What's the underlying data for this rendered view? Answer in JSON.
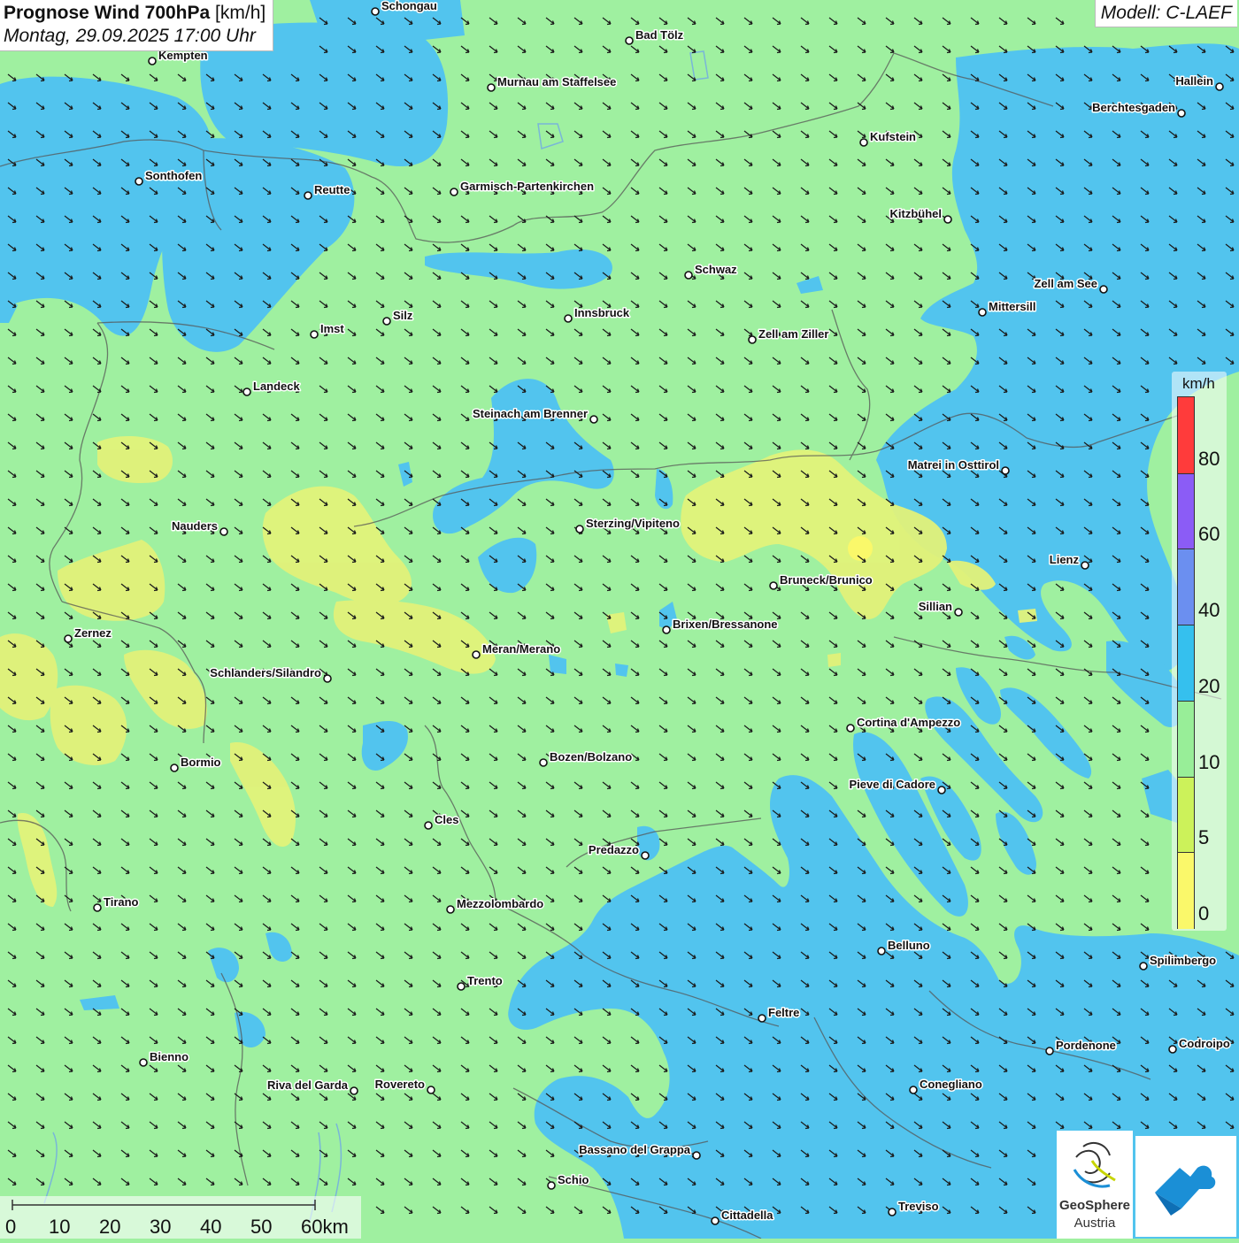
{
  "header": {
    "title": "Prognose Wind 700hPa",
    "unit": "[km/h]",
    "datetime": "Montag, 29.09.2025 17:00 Uhr",
    "model": "Modell: C-LAEF"
  },
  "legend": {
    "unit": "km/h",
    "labels": [
      "80",
      "60",
      "40",
      "20",
      "10",
      "5",
      "0"
    ],
    "colors": [
      "#ff3b3b",
      "#8b5cf6",
      "#6b8ff0",
      "#35c0ee",
      "#98ee98",
      "#ccf25a",
      "#faf86a"
    ]
  },
  "colors": {
    "green": "#9ff0a0",
    "blue": "#52c4ee",
    "yellow": "#e2f27a",
    "arrow": "#1a1a1a",
    "border": "#555555"
  },
  "wind_arrow_direction": "south-east",
  "cities": [
    {
      "name": "Schongau",
      "side": "r"
    },
    {
      "name": "Bad Tölz",
      "side": "r"
    },
    {
      "name": "Kempten",
      "side": "r"
    },
    {
      "name": "Murnau am Staffelsee",
      "side": "r"
    },
    {
      "name": "Hallein",
      "side": "l"
    },
    {
      "name": "Berchtesgaden",
      "side": "l"
    },
    {
      "name": "Kufstein",
      "side": "r"
    },
    {
      "name": "Sonthofen",
      "side": "r"
    },
    {
      "name": "Reutte",
      "side": "r"
    },
    {
      "name": "Garmisch-Partenkirchen",
      "side": "r"
    },
    {
      "name": "Kitzbühel",
      "side": "l"
    },
    {
      "name": "Schwaz",
      "side": "r"
    },
    {
      "name": "Zell am See",
      "side": "l"
    },
    {
      "name": "Innsbruck",
      "side": "r"
    },
    {
      "name": "Mittersill",
      "side": "r"
    },
    {
      "name": "Silz",
      "side": "r"
    },
    {
      "name": "Imst",
      "side": "r"
    },
    {
      "name": "Zell am Ziller",
      "side": "r"
    },
    {
      "name": "Landeck",
      "side": "r"
    },
    {
      "name": "Steinach am Brenner",
      "side": "l"
    },
    {
      "name": "Matrei in Osttirol",
      "side": "l"
    },
    {
      "name": "Nauders",
      "side": "l"
    },
    {
      "name": "Sterzing/Vipiteno",
      "side": "r"
    },
    {
      "name": "Lienz",
      "side": "l"
    },
    {
      "name": "Bruneck/Brunico",
      "side": "r"
    },
    {
      "name": "Sillian",
      "side": "l"
    },
    {
      "name": "Brixen/Bressanone",
      "side": "r"
    },
    {
      "name": "Zernez",
      "side": "r"
    },
    {
      "name": "Meran/Merano",
      "side": "r"
    },
    {
      "name": "Schlanders/Silandro",
      "side": "l"
    },
    {
      "name": "Cortina d'Ampezzo",
      "side": "r"
    },
    {
      "name": "Bozen/Bolzano",
      "side": "r"
    },
    {
      "name": "Bormio",
      "side": "r"
    },
    {
      "name": "Pieve di Cadore",
      "side": "l"
    },
    {
      "name": "Cles",
      "side": "r"
    },
    {
      "name": "Predazzo",
      "side": "l"
    },
    {
      "name": "Tirano",
      "side": "r"
    },
    {
      "name": "Mezzolombardo",
      "side": "r"
    },
    {
      "name": "Belluno",
      "side": "r"
    },
    {
      "name": "Spilimbergo",
      "side": "r"
    },
    {
      "name": "Trento",
      "side": "r"
    },
    {
      "name": "Feltre",
      "side": "r"
    },
    {
      "name": "Pordenone",
      "side": "r"
    },
    {
      "name": "Codroipo",
      "side": "r"
    },
    {
      "name": "Bienno",
      "side": "r"
    },
    {
      "name": "Riva del Garda",
      "side": "l"
    },
    {
      "name": "Rovereto",
      "side": "l"
    },
    {
      "name": "Conegliano",
      "side": "r"
    },
    {
      "name": "Bassano del Grappa",
      "side": "l"
    },
    {
      "name": "Schio",
      "side": "r"
    },
    {
      "name": "Treviso",
      "side": "r"
    },
    {
      "name": "Cittadella",
      "side": "r"
    }
  ],
  "scalebar": {
    "labels": [
      "0",
      "10",
      "20",
      "30",
      "40",
      "50",
      "60km"
    ]
  },
  "logos": {
    "geosphere_line1": "GeoSphere",
    "geosphere_line2": "Austria"
  }
}
